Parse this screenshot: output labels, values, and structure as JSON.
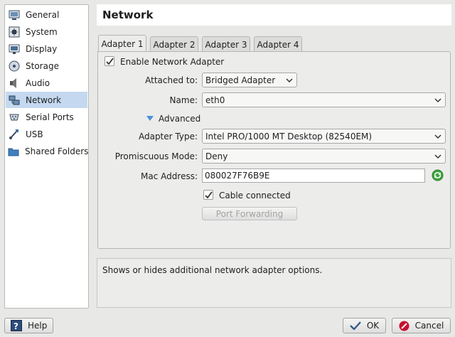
{
  "sidebar": {
    "items": [
      {
        "label": "General",
        "icon": "general-icon"
      },
      {
        "label": "System",
        "icon": "system-icon"
      },
      {
        "label": "Display",
        "icon": "display-icon"
      },
      {
        "label": "Storage",
        "icon": "storage-icon"
      },
      {
        "label": "Audio",
        "icon": "audio-icon"
      },
      {
        "label": "Network",
        "icon": "network-icon",
        "selected": true
      },
      {
        "label": "Serial Ports",
        "icon": "serial-ports-icon"
      },
      {
        "label": "USB",
        "icon": "usb-icon"
      },
      {
        "label": "Shared Folders",
        "icon": "shared-folders-icon"
      }
    ]
  },
  "header": {
    "title": "Network"
  },
  "tabs": [
    {
      "label": "Adapter 1",
      "active": true
    },
    {
      "label": "Adapter 2"
    },
    {
      "label": "Adapter 3"
    },
    {
      "label": "Adapter 4"
    }
  ],
  "adapter": {
    "enable_label": "Enable Network Adapter",
    "enable_checked": true,
    "attached_label": "Attached to:",
    "attached_value": "Bridged Adapter",
    "name_label": "Name:",
    "name_value": "eth0",
    "advanced_label": "Advanced",
    "type_label": "Adapter Type:",
    "type_value": "Intel PRO/1000 MT Desktop (82540EM)",
    "promisc_label": "Promiscuous Mode:",
    "promisc_value": "Deny",
    "mac_label": "Mac Address:",
    "mac_value": "080027F76B9E",
    "cable_label": "Cable connected",
    "cable_checked": true,
    "port_forwarding_label": "Port Forwarding"
  },
  "description": "Shows or hides additional network adapter options.",
  "footer": {
    "help_label": "Help",
    "ok_label": "OK",
    "cancel_label": "Cancel"
  },
  "colors": {
    "selection": "#c4d9ef",
    "ok_check": "#3a5a8c",
    "cancel_red": "#c8102e",
    "refresh_green": "#3aa53a"
  }
}
